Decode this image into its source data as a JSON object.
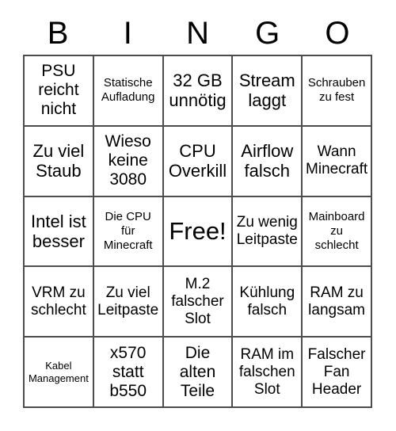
{
  "card": {
    "title": "BINGO",
    "header_letters": [
      "B",
      "I",
      "N",
      "G",
      "O"
    ],
    "colors": {
      "background": "#ffffff",
      "grid_line": "#4d4d4d",
      "text": "#000000"
    },
    "grid_size": "5x5",
    "free_space_label": "Free!",
    "cells": [
      {
        "text": "PSU\nreicht\nnicht",
        "size": "lg",
        "column": "B",
        "row": 1,
        "free": false
      },
      {
        "text": "Statische\nAufladung",
        "size": "sm",
        "column": "I",
        "row": 1,
        "free": false
      },
      {
        "text": "32 GB\nunnötig",
        "size": "xl",
        "column": "N",
        "row": 1,
        "free": false
      },
      {
        "text": "Stream\nlaggt",
        "size": "xl",
        "column": "G",
        "row": 1,
        "free": false
      },
      {
        "text": "Schrauben\nzu fest",
        "size": "sm",
        "column": "O",
        "row": 1,
        "free": false
      },
      {
        "text": "Zu viel\nStaub",
        "size": "xl",
        "column": "B",
        "row": 2,
        "free": false
      },
      {
        "text": "Wieso\nkeine\n3080",
        "size": "lg",
        "column": "I",
        "row": 2,
        "free": false
      },
      {
        "text": "CPU\nOverkill",
        "size": "xl",
        "column": "N",
        "row": 2,
        "free": false
      },
      {
        "text": "Airflow\nfalsch",
        "size": "xl",
        "column": "G",
        "row": 2,
        "free": false
      },
      {
        "text": "Wann\nMinecraft",
        "size": "md",
        "column": "O",
        "row": 2,
        "free": false
      },
      {
        "text": "Intel ist\nbesser",
        "size": "xl",
        "column": "B",
        "row": 3,
        "free": false
      },
      {
        "text": "Die CPU\nfür\nMinecraft",
        "size": "sm",
        "column": "I",
        "row": 3,
        "free": false
      },
      {
        "text": "Free!",
        "size": "xxl",
        "column": "N",
        "row": 3,
        "free": true
      },
      {
        "text": "Zu wenig\nLeitpaste",
        "size": "md",
        "column": "G",
        "row": 3,
        "free": false
      },
      {
        "text": "Mainboard\nzu\nschlecht",
        "size": "sm",
        "column": "O",
        "row": 3,
        "free": false
      },
      {
        "text": "VRM zu\nschlecht",
        "size": "md",
        "column": "B",
        "row": 4,
        "free": false
      },
      {
        "text": "Zu viel\nLeitpaste",
        "size": "md",
        "column": "I",
        "row": 4,
        "free": false
      },
      {
        "text": "M.2\nfalscher\nSlot",
        "size": "md",
        "column": "N",
        "row": 4,
        "free": false
      },
      {
        "text": "Kühlung\nfalsch",
        "size": "md",
        "column": "G",
        "row": 4,
        "free": false
      },
      {
        "text": "RAM zu\nlangsam",
        "size": "md",
        "column": "O",
        "row": 4,
        "free": false
      },
      {
        "text": "Kabel\nManagement",
        "size": "xs",
        "column": "B",
        "row": 5,
        "free": false
      },
      {
        "text": "x570\nstatt\nb550",
        "size": "lg",
        "column": "I",
        "row": 5,
        "free": false
      },
      {
        "text": "Die\nalten\nTeile",
        "size": "lg",
        "column": "N",
        "row": 5,
        "free": false
      },
      {
        "text": "RAM im\nfalschen\nSlot",
        "size": "md",
        "column": "G",
        "row": 5,
        "free": false
      },
      {
        "text": "Falscher\nFan\nHeader",
        "size": "md",
        "column": "O",
        "row": 5,
        "free": false
      }
    ]
  }
}
